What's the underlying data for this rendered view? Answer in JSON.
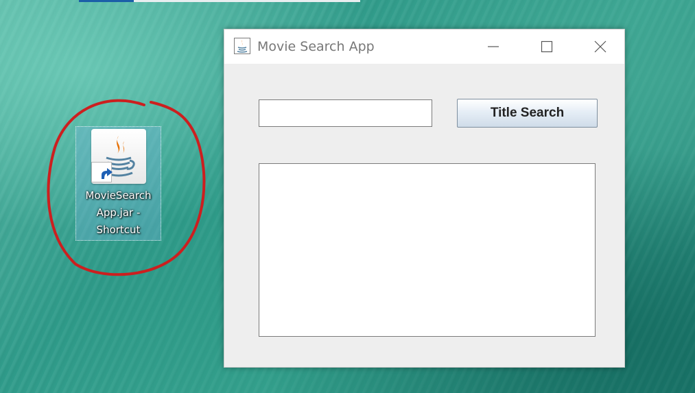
{
  "desktop": {
    "shortcut_icon": {
      "label": "MovieSearch\nApp.jar -\nShortcut",
      "icon": "java-icon",
      "overlay_icon": "shortcut-arrow-icon"
    },
    "annotation_color": "#cc1f1f"
  },
  "window": {
    "title": "Movie Search App",
    "title_icon": "java-icon",
    "controls": {
      "minimize": "minimize-icon",
      "maximize": "maximize-icon",
      "close": "close-icon"
    },
    "search": {
      "value": "",
      "button_label": "Title Search"
    },
    "results": {
      "value": ""
    }
  }
}
